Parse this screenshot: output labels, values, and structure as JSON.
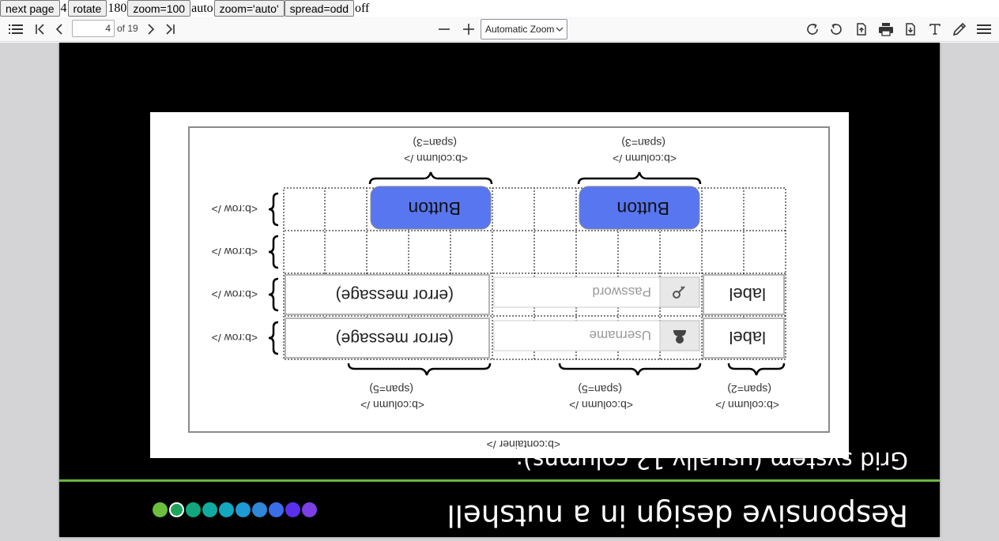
{
  "testbar": {
    "next_label": "next page",
    "page_value": "4",
    "rotate_label": "rotate",
    "rotate_value": "180",
    "zoom100_label": "zoom=100",
    "zoom_value": "auto",
    "zoom_auto_label": "zoom='auto'",
    "spread_label": "spread=odd",
    "spread_value": "off"
  },
  "toolbar": {
    "page_number": "4",
    "page_count": "of 19",
    "zoom_selected": "Automatic Zoom",
    "icons": [
      "sidebar-toggle",
      "first-page",
      "previous-page",
      "next-page",
      "last-page",
      "zoom-out",
      "zoom-in",
      "rotate-clockwise",
      "rotate-counterclockwise",
      "open-file",
      "print",
      "save",
      "text-tool",
      "draw-tool",
      "menu"
    ]
  },
  "slide": {
    "rotation_degrees": 180,
    "title": "Responsive design in a nutshell",
    "subtitle": "Grid system (usually 12 columns):",
    "dot_colors": [
      "#7b3fe4",
      "#5b2ff0",
      "#3a6ee8",
      "#2f86d9",
      "#1e9bd6",
      "#13a7c0",
      "#10aaa0",
      "#12a67d",
      "#1ea35a",
      "#6abf3f"
    ],
    "active_dot": 8,
    "diagram": {
      "container_label": "<b:container />",
      "row_label": "<b:row />",
      "buttons": [
        "Button",
        "Button"
      ],
      "labels": [
        "label",
        "label"
      ],
      "inputs": [
        {
          "placeholder": "Username",
          "icon": "user-icon"
        },
        {
          "placeholder": "Password",
          "icon": "key-icon"
        }
      ],
      "errors": [
        "(error message)",
        "(error message)"
      ],
      "bottom_columns": [
        {
          "tag": "<b:column />",
          "span": "(span=2)"
        },
        {
          "tag": "<b:column />",
          "span": "(span=5)"
        },
        {
          "tag": "<b:column />",
          "span": "(span=5)"
        }
      ],
      "top_columns": [
        {
          "tag": "<b:column />",
          "span": "(span=3)"
        },
        {
          "tag": "<b:column />",
          "span": "(span=3)"
        }
      ]
    }
  }
}
